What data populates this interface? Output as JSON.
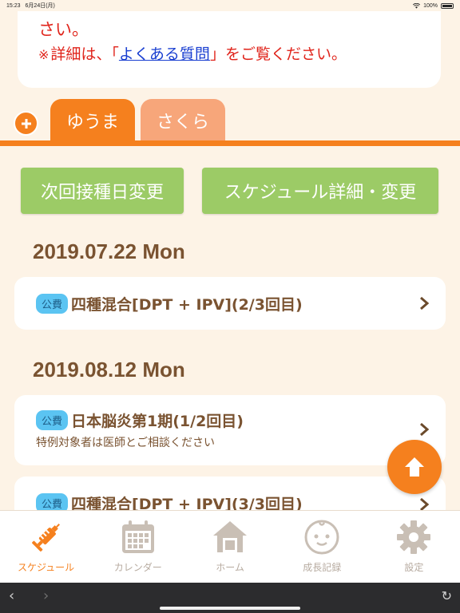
{
  "status_bar": {
    "time": "15:23",
    "date": "6月24日(月)",
    "battery": "100%"
  },
  "notice": {
    "line1": "さい。",
    "mark": "※",
    "prefix": "詳細は、「",
    "link": "よくある質問",
    "suffix": "」をご覧ください。"
  },
  "tabs": [
    {
      "label": "ゆうま",
      "active": true
    },
    {
      "label": "さくら",
      "active": false
    }
  ],
  "buttons": {
    "next_date": "次回接種日変更",
    "schedule_detail": "スケジュール詳細・変更"
  },
  "schedule": [
    {
      "date": "2019.07.22 Mon",
      "items": [
        {
          "badge": "公費",
          "name": "四種混合[DPT + IPV](2/3回目)",
          "note": ""
        }
      ]
    },
    {
      "date": "2019.08.12 Mon",
      "items": [
        {
          "badge": "公費",
          "name": "日本脳炎第1期(1/2回目)",
          "note": "特例対象者は医師とご相談ください"
        },
        {
          "badge": "公費",
          "name": "四種混合[DPT + IPV](3/3回目)",
          "note": ""
        }
      ]
    }
  ],
  "nav": [
    {
      "label": "スケジュール",
      "icon": "syringe-icon",
      "active": true
    },
    {
      "label": "カレンダー",
      "icon": "calendar-icon",
      "active": false
    },
    {
      "label": "ホーム",
      "icon": "house-icon",
      "active": false
    },
    {
      "label": "成長記録",
      "icon": "baby-face-icon",
      "active": false
    },
    {
      "label": "設定",
      "icon": "gear-icon",
      "active": false
    }
  ],
  "colors": {
    "accent": "#f5801e",
    "tab_inactive": "#f7a67a",
    "button_green": "#9ccb66",
    "badge_blue": "#5bc4f2",
    "notice_red": "#e0241b",
    "link_blue": "#1a3fd1",
    "text_brown": "#7a5331",
    "nav_inactive": "#b7aba0"
  }
}
